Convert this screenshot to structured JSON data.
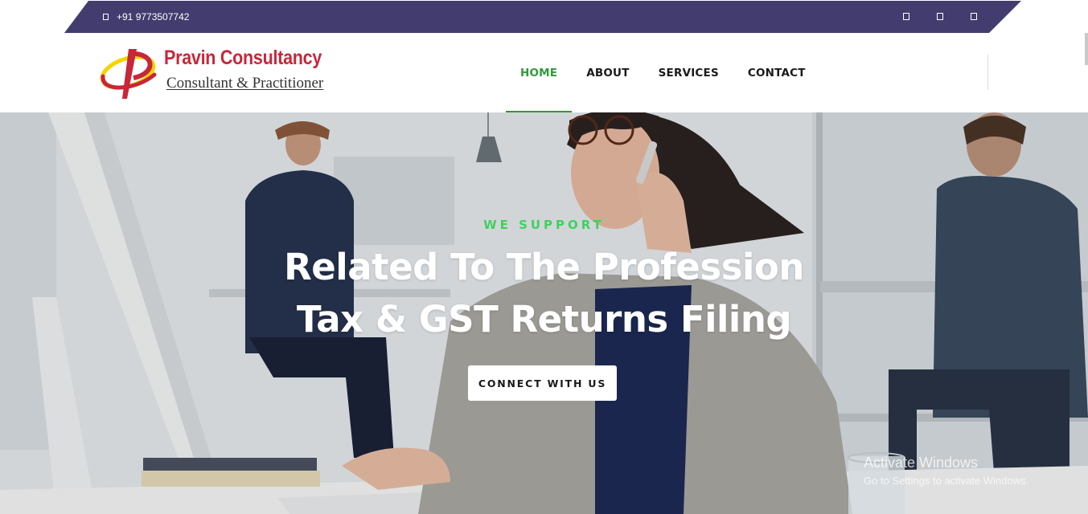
{
  "topbar": {
    "phone": "+91 9773507742",
    "phone_icon": "phone-icon",
    "social_icons": [
      "facebook-icon",
      "twitter-icon",
      "instagram-icon"
    ]
  },
  "brand": {
    "name": "Pravin Consultancy",
    "tagline": "Consultant & Practitioner"
  },
  "nav": {
    "items": [
      {
        "label": "HOME",
        "active": true
      },
      {
        "label": "ABOUT",
        "active": false
      },
      {
        "label": "SERVICES",
        "active": false
      },
      {
        "label": "CONTACT",
        "active": false
      }
    ]
  },
  "hero": {
    "kicker": "WE SUPPORT",
    "headline_line1": "Related To The Profession",
    "headline_line2": "Tax & GST Returns Filing",
    "cta_label": "CONNECT WITH US"
  },
  "watermark": {
    "line1": "Activate Windows",
    "line2": "Go to Settings to activate Windows."
  },
  "colors": {
    "topbar_bg": "#433c6f",
    "brand_red": "#c8263a",
    "nav_active": "#2f9a3a",
    "kicker_green": "#3fd160"
  }
}
